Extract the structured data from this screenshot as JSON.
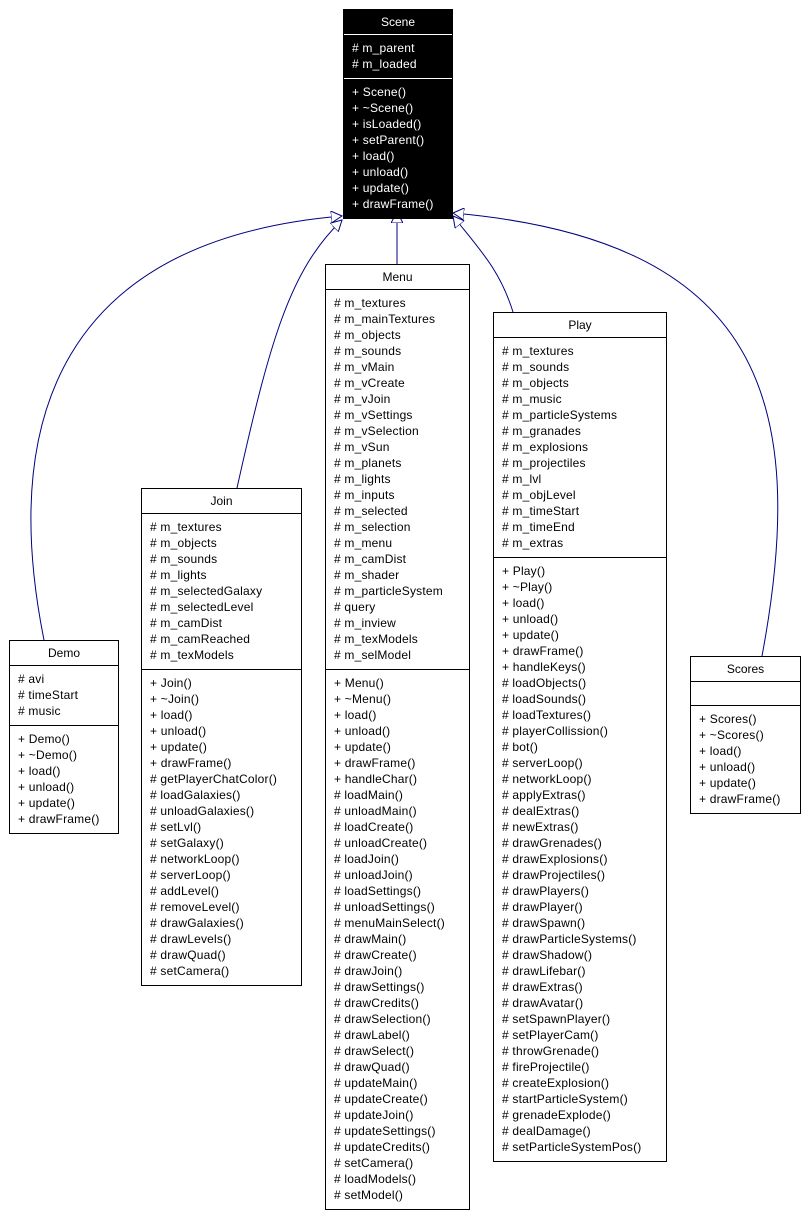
{
  "diagram": {
    "type": "uml-class-inheritance",
    "edge_color": "#000080",
    "base_class": "Scene",
    "classes": [
      {
        "name": "Scene",
        "highlighted": true,
        "attributes": [
          "# m_parent",
          "# m_loaded"
        ],
        "methods": [
          "+ Scene()",
          "+ ~Scene()",
          "+ isLoaded()",
          "+ setParent()",
          "+ load()",
          "+ unload()",
          "+ update()",
          "+ drawFrame()"
        ]
      },
      {
        "name": "Demo",
        "parent": "Scene",
        "attributes": [
          "# avi",
          "# timeStart",
          "# music"
        ],
        "methods": [
          "+ Demo()",
          "+ ~Demo()",
          "+ load()",
          "+ unload()",
          "+ update()",
          "+ drawFrame()"
        ]
      },
      {
        "name": "Join",
        "parent": "Scene",
        "attributes": [
          "# m_textures",
          "# m_objects",
          "# m_sounds",
          "# m_lights",
          "# m_selectedGalaxy",
          "# m_selectedLevel",
          "# m_camDist",
          "# m_camReached",
          "# m_texModels"
        ],
        "methods": [
          "+ Join()",
          "+ ~Join()",
          "+ load()",
          "+ unload()",
          "+ update()",
          "+ drawFrame()",
          "# getPlayerChatColor()",
          "# loadGalaxies()",
          "# unloadGalaxies()",
          "# setLvl()",
          "# setGalaxy()",
          "# networkLoop()",
          "# serverLoop()",
          "# addLevel()",
          "# removeLevel()",
          "# drawGalaxies()",
          "# drawLevels()",
          "# drawQuad()",
          "# setCamera()"
        ]
      },
      {
        "name": "Menu",
        "parent": "Scene",
        "attributes": [
          "# m_textures",
          "# m_mainTextures",
          "# m_objects",
          "# m_sounds",
          "# m_vMain",
          "# m_vCreate",
          "# m_vJoin",
          "# m_vSettings",
          "# m_vSelection",
          "# m_vSun",
          "# m_planets",
          "# m_lights",
          "# m_inputs",
          "# m_selected",
          "# m_selection",
          "# m_menu",
          "# m_camDist",
          "# m_shader",
          "# m_particleSystem",
          "# query",
          "# m_inview",
          "# m_texModels",
          "# m_selModel"
        ],
        "methods": [
          "+ Menu()",
          "+ ~Menu()",
          "+ load()",
          "+ unload()",
          "+ update()",
          "+ drawFrame()",
          "+ handleChar()",
          "# loadMain()",
          "# unloadMain()",
          "# loadCreate()",
          "# unloadCreate()",
          "# loadJoin()",
          "# unloadJoin()",
          "# loadSettings()",
          "# unloadSettings()",
          "# menuMainSelect()",
          "# drawMain()",
          "# drawCreate()",
          "# drawJoin()",
          "# drawSettings()",
          "# drawCredits()",
          "# drawSelection()",
          "# drawLabel()",
          "# drawSelect()",
          "# drawQuad()",
          "# updateMain()",
          "# updateCreate()",
          "# updateJoin()",
          "# updateSettings()",
          "# updateCredits()",
          "# setCamera()",
          "# loadModels()",
          "# setModel()"
        ]
      },
      {
        "name": "Play",
        "parent": "Scene",
        "attributes": [
          "# m_textures",
          "# m_sounds",
          "# m_objects",
          "# m_music",
          "# m_particleSystems",
          "# m_granades",
          "# m_explosions",
          "# m_projectiles",
          "# m_lvl",
          "# m_objLevel",
          "# m_timeStart",
          "# m_timeEnd",
          "# m_extras"
        ],
        "methods": [
          "+ Play()",
          "+ ~Play()",
          "+ load()",
          "+ unload()",
          "+ update()",
          "+ drawFrame()",
          "+ handleKeys()",
          "# loadObjects()",
          "# loadSounds()",
          "# loadTextures()",
          "# playerCollission()",
          "# bot()",
          "# serverLoop()",
          "# networkLoop()",
          "# applyExtras()",
          "# dealExtras()",
          "# newExtras()",
          "# drawGrenades()",
          "# drawExplosions()",
          "# drawProjectiles()",
          "# drawPlayers()",
          "# drawPlayer()",
          "# drawSpawn()",
          "# drawParticleSystems()",
          "# drawShadow()",
          "# drawLifebar()",
          "# drawExtras()",
          "# drawAvatar()",
          "# setSpawnPlayer()",
          "# setPlayerCam()",
          "# throwGrenade()",
          "# fireProjectile()",
          "# createExplosion()",
          "# startParticleSystem()",
          "# grenadeExplode()",
          "# dealDamage()",
          "# setParticleSystemPos()"
        ]
      },
      {
        "name": "Scores",
        "parent": "Scene",
        "attributes": [],
        "methods": [
          "+ Scores()",
          "+ ~Scores()",
          "+ load()",
          "+ unload()",
          "+ update()",
          "+ drawFrame()"
        ]
      }
    ]
  }
}
